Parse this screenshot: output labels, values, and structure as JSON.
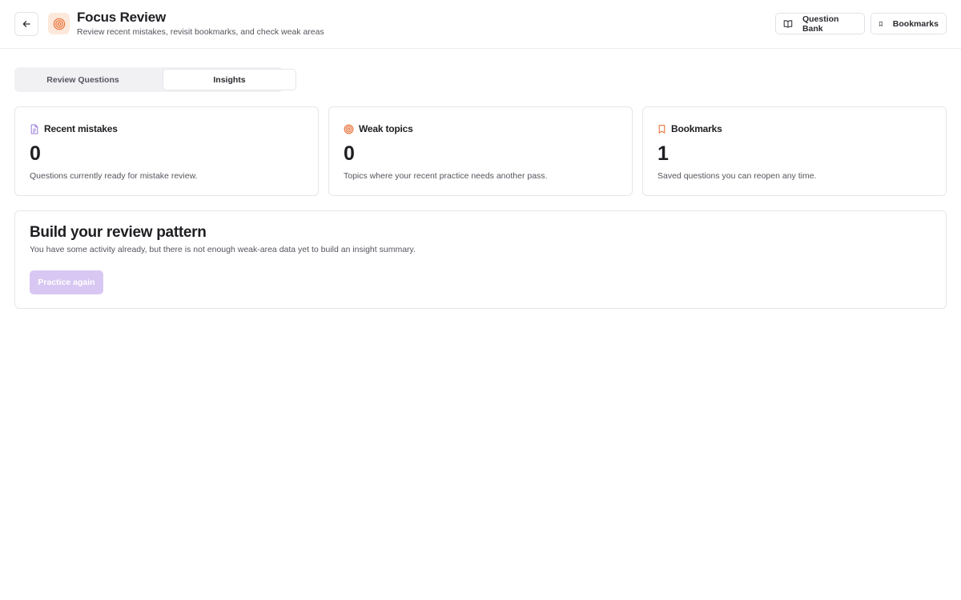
{
  "header": {
    "title": "Focus Review",
    "subtitle": "Review recent mistakes, revisit bookmarks, and check weak areas",
    "back_icon": "arrow-left-icon",
    "logo_icon": "target-icon",
    "question_bank_label": "Question Bank",
    "question_bank_icon": "open-book-icon",
    "bookmarks_label": "Bookmarks",
    "bookmarks_icon": "bookmark-icon"
  },
  "tabs": [
    {
      "label": "Review Questions",
      "active": false
    },
    {
      "label": "Insights",
      "active": true
    }
  ],
  "cards": [
    {
      "icon": "document-icon",
      "title": "Recent mistakes",
      "value": "0",
      "description": "Questions currently ready for mistake review."
    },
    {
      "icon": "target-icon",
      "title": "Weak topics",
      "value": "0",
      "description": "Topics where your recent practice needs another pass."
    },
    {
      "icon": "bookmark-icon",
      "title": "Bookmarks",
      "value": "1",
      "description": "Saved questions you can reopen any time."
    }
  ],
  "insight_panel": {
    "title": "Build your review pattern",
    "description": "You have some activity already, but there is not enough weak-area data yet to build an insight summary.",
    "button_label": "Practice again"
  },
  "colors": {
    "accent_orange": "#e8743b",
    "accent_purple_disabled": "#d8c7f2",
    "border": "#e6e6ea"
  }
}
